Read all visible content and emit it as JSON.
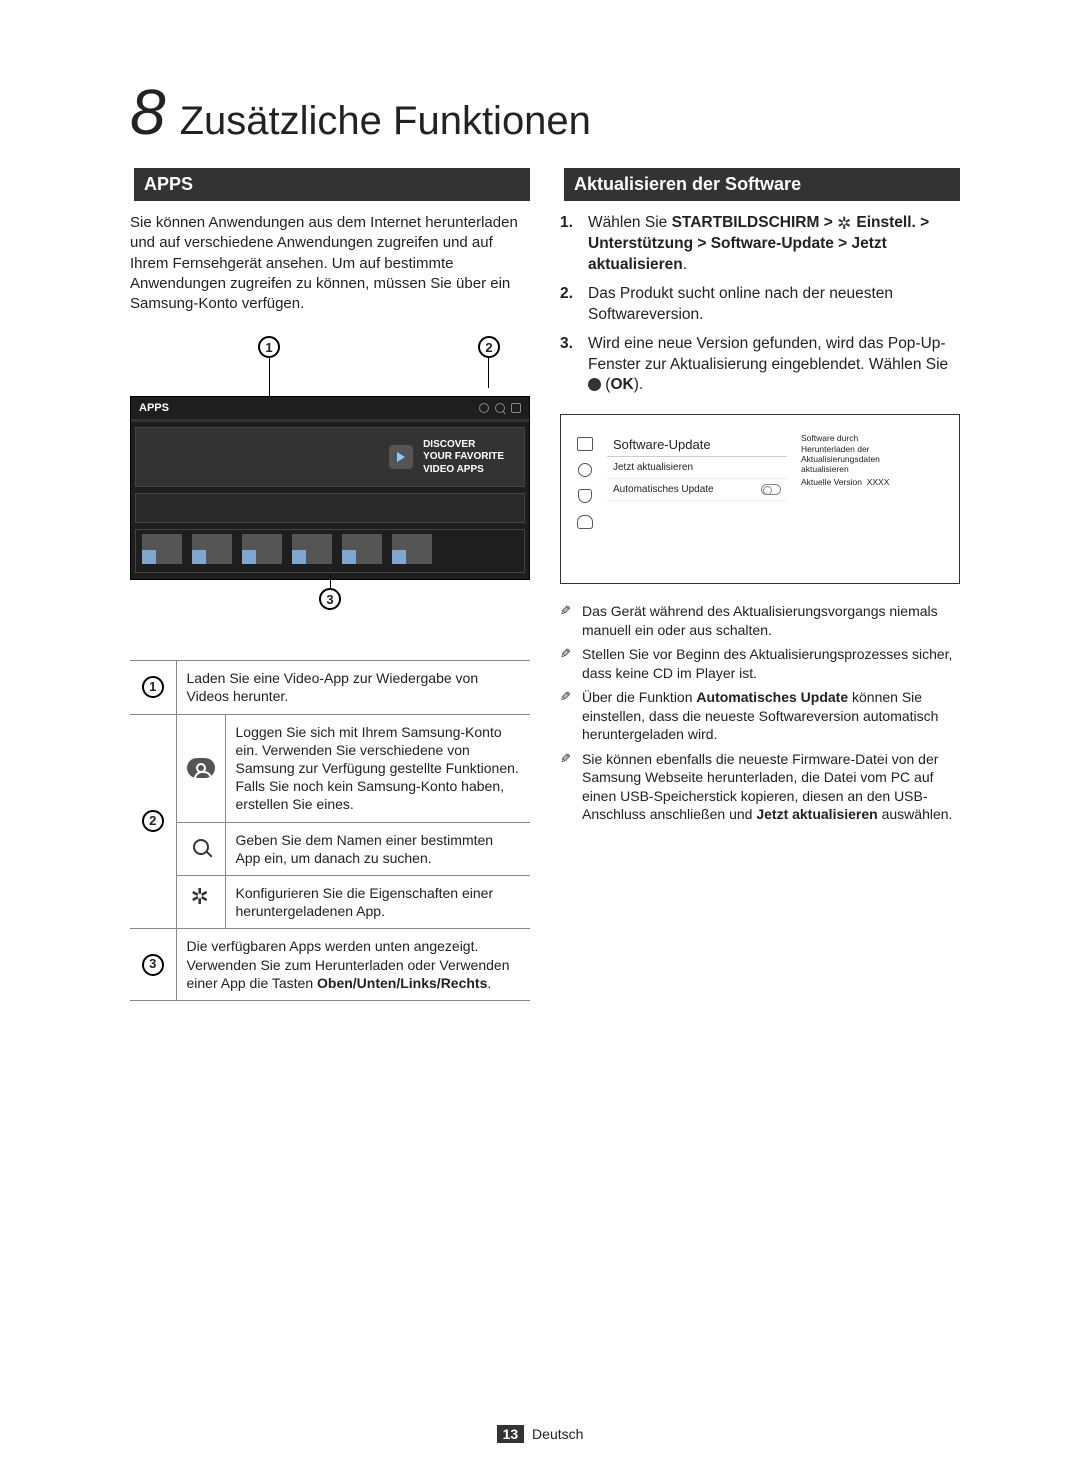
{
  "chapter": {
    "number": "8",
    "title": "Zusätzliche Funktionen"
  },
  "left": {
    "heading": "APPS",
    "intro": "Sie können Anwendungen aus dem Internet herunterladen und auf verschiedene Anwendungen zugreifen und auf Ihrem Fernsehgerät ansehen. Um auf bestimmte Anwendungen zugreifen zu können, müssen Sie über ein Samsung-Konto verfügen.",
    "callouts": {
      "c1": "1",
      "c2": "2",
      "c3": "3"
    },
    "appsBox": {
      "title": "APPS",
      "featuredLine1": "DISCOVER",
      "featuredLine2": "YOUR FAVORITE",
      "featuredLine3": "VIDEO APPS"
    },
    "legend": {
      "row1": "Laden Sie eine Video-App zur Wiedergabe von Videos herunter.",
      "row2a": "Loggen Sie sich mit Ihrem Samsung-Konto ein. Verwenden Sie verschiedene von Samsung zur Verfügung gestellte Funktionen. Falls Sie noch kein Samsung-Konto haben, erstellen Sie eines.",
      "row2b": "Geben Sie dem Namen einer bestimmten App ein, um danach zu suchen.",
      "row2c": "Konfigurieren Sie die Eigenschaften einer heruntergeladenen App.",
      "row3_pre": "Die verfügbaren Apps werden unten angezeigt. Verwenden Sie zum Herunterladen oder Verwenden einer App die Tasten ",
      "row3_bold": "Oben/Unten/Links/Rechts",
      "row3_post": "."
    }
  },
  "right": {
    "heading": "Aktualisieren der Software",
    "step1": {
      "pre": "Wählen Sie ",
      "bold1": "STARTBILDSCHIRM > ",
      "bold2": " Einstell. > Unterstützung > Software-Update > Jetzt aktualisieren",
      "post": "."
    },
    "step2": "Das Produkt sucht online nach der neuesten Softwareversion.",
    "step3": {
      "pre": "Wird eine neue Version gefunden, wird das Pop-Up-Fenster zur Aktualisierung eingeblendet. Wählen Sie ",
      "ok": "OK",
      "post": ")."
    },
    "panel": {
      "title": "Software-Update",
      "item1": "Jetzt aktualisieren",
      "item2": "Automatisches Update",
      "descLine1": "Software durch",
      "descLine2": "Herunterladen der",
      "descLine3": "Aktualisierungsdaten",
      "descLine4": "aktualisieren",
      "versionLabel": "Aktuelle Version",
      "versionValue": "XXXX"
    },
    "notes": {
      "n1": "Das Gerät während des Aktualisierungsvorgangs niemals manuell ein oder aus schalten.",
      "n2": "Stellen Sie vor Beginn des Aktualisierungsprozesses sicher, dass keine CD im Player ist.",
      "n3_pre": "Über die Funktion ",
      "n3_bold": "Automatisches Update",
      "n3_post": " können Sie einstellen, dass die neueste Softwareversion automatisch heruntergeladen wird.",
      "n4_pre": "Sie können ebenfalls die neueste Firmware-Datei von der Samsung Webseite herunterladen, die Datei vom PC auf einen USB-Speicherstick kopieren, diesen an den USB-Anschluss anschließen und ",
      "n4_bold": "Jetzt aktualisieren",
      "n4_post": " auswählen."
    }
  },
  "footer": {
    "page": "13",
    "lang": "Deutsch"
  }
}
